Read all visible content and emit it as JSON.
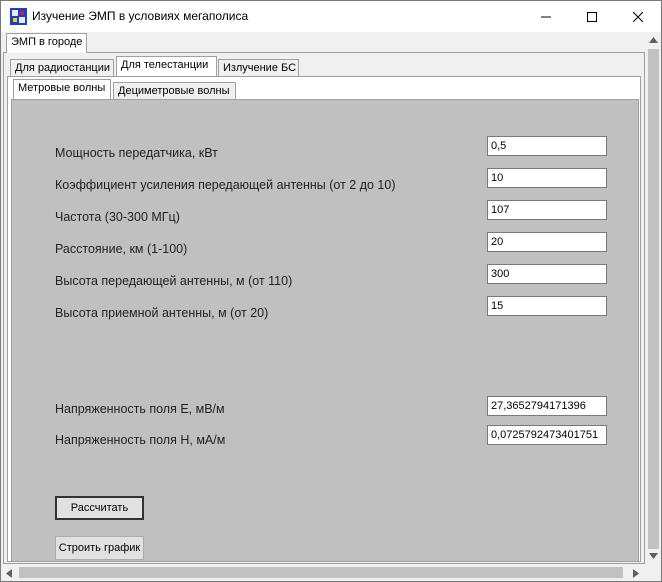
{
  "window": {
    "title": "Изучение ЭМП в условиях мегаполиса",
    "icon": "app-icon",
    "controls": {
      "minimize": "minimize-icon",
      "maximize": "maximize-icon",
      "close": "close-icon"
    }
  },
  "tabs_level1": [
    {
      "label": "ЭМП в городе",
      "active": true
    }
  ],
  "tabs_level2": [
    {
      "label": "Для радиостанции",
      "active": false
    },
    {
      "label": "Для телестанции",
      "active": true
    },
    {
      "label": "Излучение БС",
      "active": false
    }
  ],
  "tabs_level3": [
    {
      "label": "Метровые волны",
      "active": true
    },
    {
      "label": "Дециметровые волны",
      "active": false
    }
  ],
  "form": {
    "fields": [
      {
        "label": "Мощность передатчика, кВт",
        "value": "0,5"
      },
      {
        "label": "Коэффициент усиления передающей антенны (от 2 до 10)",
        "value": "10"
      },
      {
        "label": "Частота (30-300 МГц)",
        "value": "107"
      },
      {
        "label": "Расстояние, км (1-100)",
        "value": "20"
      },
      {
        "label": "Высота передающей антенны, м (от 110)",
        "value": "300"
      },
      {
        "label": "Высота приемной антенны, м (от 20)",
        "value": "15"
      }
    ],
    "results": [
      {
        "label": "Напряженность поля E, мВ/м",
        "value": "27,3652794171396"
      },
      {
        "label": "Напряженность поля H, мА/м",
        "value": "0,0725792473401751"
      }
    ],
    "buttons": {
      "calculate": "Рассчитать",
      "plot": "Строить график"
    }
  },
  "colors": {
    "panel_bg": "#c0c0c0",
    "window_bg": "#f0f0f0",
    "scrollbar_thumb": "#c1c1c1"
  }
}
